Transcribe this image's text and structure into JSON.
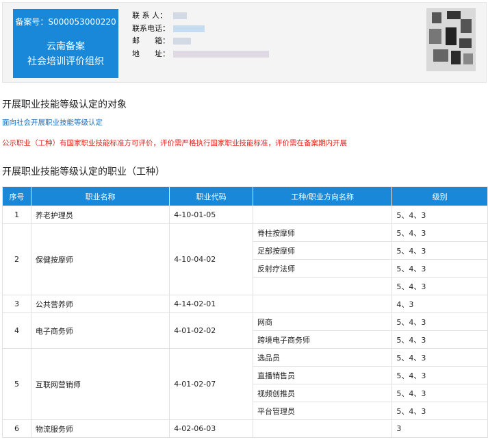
{
  "org": {
    "record_label": "备案号：S000053000220",
    "name_line1": "云南备案",
    "name_line2": "社会培训评价组织"
  },
  "contact": {
    "person_label": "联 系 人：",
    "phone_label": "联系电话：",
    "postcode_label": "邮　　箱：",
    "address_label": "地　　址："
  },
  "sections": {
    "target_title": "开展职业技能等级认定的对象",
    "target_link": "面向社会开展职业技能等级认定",
    "notice": "公示职业（工种）有国家职业技能标准方可评价，评价需严格执行国家职业技能标准，评价需在备案期内开展",
    "occupation_title": "开展职业技能等级认定的职业（工种）"
  },
  "table": {
    "headers": [
      "序号",
      "职业名称",
      "职业代码",
      "工种/职业方向名称",
      "级别"
    ],
    "rows": [
      {
        "no": "1",
        "name": "养老护理员",
        "code": "4-10-01-05",
        "sub": [
          {
            "type": "",
            "level": "5、4、3"
          }
        ]
      },
      {
        "no": "2",
        "name": "保健按摩师",
        "code": "4-10-04-02",
        "sub": [
          {
            "type": "脊柱按摩师",
            "level": "5、4、3"
          },
          {
            "type": "足部按摩师",
            "level": "5、4、3"
          },
          {
            "type": "反射疗法师",
            "level": "5、4、3"
          },
          {
            "type": "",
            "level": "5、4、3"
          }
        ]
      },
      {
        "no": "3",
        "name": "公共营养师",
        "code": "4-14-02-01",
        "sub": [
          {
            "type": "",
            "level": "4、3"
          }
        ]
      },
      {
        "no": "4",
        "name": "电子商务师",
        "code": "4-01-02-02",
        "sub": [
          {
            "type": "网商",
            "level": "5、4、3"
          },
          {
            "type": "跨境电子商务师",
            "level": "5、4、3"
          }
        ]
      },
      {
        "no": "5",
        "name": "互联网营销师",
        "code": "4-01-02-07",
        "sub": [
          {
            "type": "选品员",
            "level": "5、4、3"
          },
          {
            "type": "直播销售员",
            "level": "5、4、3"
          },
          {
            "type": "视频创推员",
            "level": "5、4、3"
          },
          {
            "type": "平台管理员",
            "level": "5、4、3"
          }
        ]
      },
      {
        "no": "6",
        "name": "物流服务师",
        "code": "4-02-06-03",
        "sub": [
          {
            "type": "",
            "level": "3"
          }
        ]
      }
    ]
  }
}
